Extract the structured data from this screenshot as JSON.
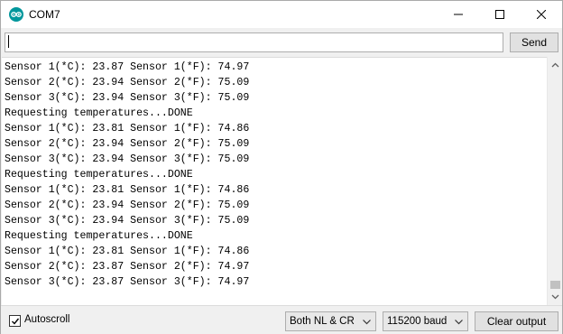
{
  "window": {
    "title": "COM7"
  },
  "input": {
    "value": "",
    "send_label": "Send"
  },
  "output": {
    "lines": [
      "Sensor 1(*C): 23.87 Sensor 1(*F): 74.97",
      "Sensor 2(*C): 23.94 Sensor 2(*F): 75.09",
      "Sensor 3(*C): 23.94 Sensor 3(*F): 75.09",
      "Requesting temperatures...DONE",
      "Sensor 1(*C): 23.81 Sensor 1(*F): 74.86",
      "Sensor 2(*C): 23.94 Sensor 2(*F): 75.09",
      "Sensor 3(*C): 23.94 Sensor 3(*F): 75.09",
      "Requesting temperatures...DONE",
      "Sensor 1(*C): 23.81 Sensor 1(*F): 74.86",
      "Sensor 2(*C): 23.94 Sensor 2(*F): 75.09",
      "Sensor 3(*C): 23.94 Sensor 3(*F): 75.09",
      "Requesting temperatures...DONE",
      "Sensor 1(*C): 23.81 Sensor 1(*F): 74.86",
      "Sensor 2(*C): 23.87 Sensor 2(*F): 74.97",
      "Sensor 3(*C): 23.87 Sensor 3(*F): 74.97"
    ]
  },
  "footer": {
    "autoscroll_label": "Autoscroll",
    "autoscroll_checked": true,
    "line_ending": "Both NL & CR",
    "baud_rate": "115200 baud",
    "clear_label": "Clear output"
  },
  "colors": {
    "icon_teal": "#00979c",
    "background": "#f0f0f0"
  }
}
